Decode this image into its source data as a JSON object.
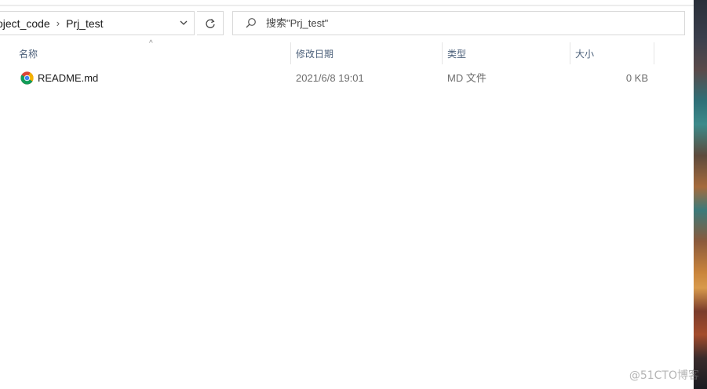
{
  "address_bar": {
    "crumbs": [
      "oject_code",
      "Prj_test"
    ],
    "separator": "›",
    "dropdown_glyph": "⌵",
    "refresh_glyph": "↻"
  },
  "search": {
    "placeholder": "搜索\"Prj_test\""
  },
  "columns": {
    "name": "名称",
    "modified": "修改日期",
    "type": "类型",
    "size": "大小",
    "sort_glyph": "^"
  },
  "files": [
    {
      "icon": "chrome-icon",
      "name": "README.md",
      "modified": "2021/6/8 19:01",
      "type": "MD 文件",
      "size": "0 KB"
    }
  ],
  "watermark": "@51CTO博客",
  "colors": {
    "header_text": "#4c607a",
    "border": "#d9d9d9"
  }
}
